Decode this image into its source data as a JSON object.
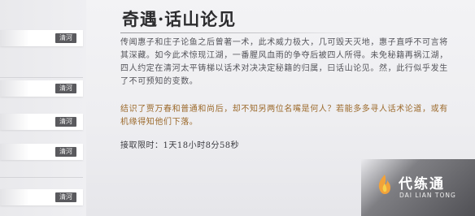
{
  "sidebar": {
    "items": [
      {
        "tag": "清河"
      },
      {
        "tag": "清河"
      },
      {
        "tag": "清河"
      },
      {
        "tag": "清河"
      },
      {
        "tag": "清河"
      }
    ]
  },
  "quest": {
    "title": "奇遇·话山论见",
    "description": "传闻惠子和庄子论鱼之后曾著一术，此术威力极大，几可毁天灭地，惠子直呼不可言将其深藏。如今此术惊现江湖，一番腥风血雨的争夺后被四人所得。未免秘籍再祸江湖，四人约定在清河太平铸梯以话术对决决定秘籍的归属，曰话山论见。然，此行似乎发生了不可预知的变数。",
    "hint": "结识了贾万春和普通和尚后，却不知另两位名嘴是何人？若能多多寻人话术论道，或有机缘得知他们下落。",
    "timer_label": "接取限时：",
    "timer_value": "1天18小时8分58秒"
  },
  "watermark": {
    "cn": "代练通",
    "en": "DAI LIAN TONG",
    "colors": {
      "logo_orange": "#f2a23a",
      "logo_yellow": "#f6d14a"
    }
  }
}
